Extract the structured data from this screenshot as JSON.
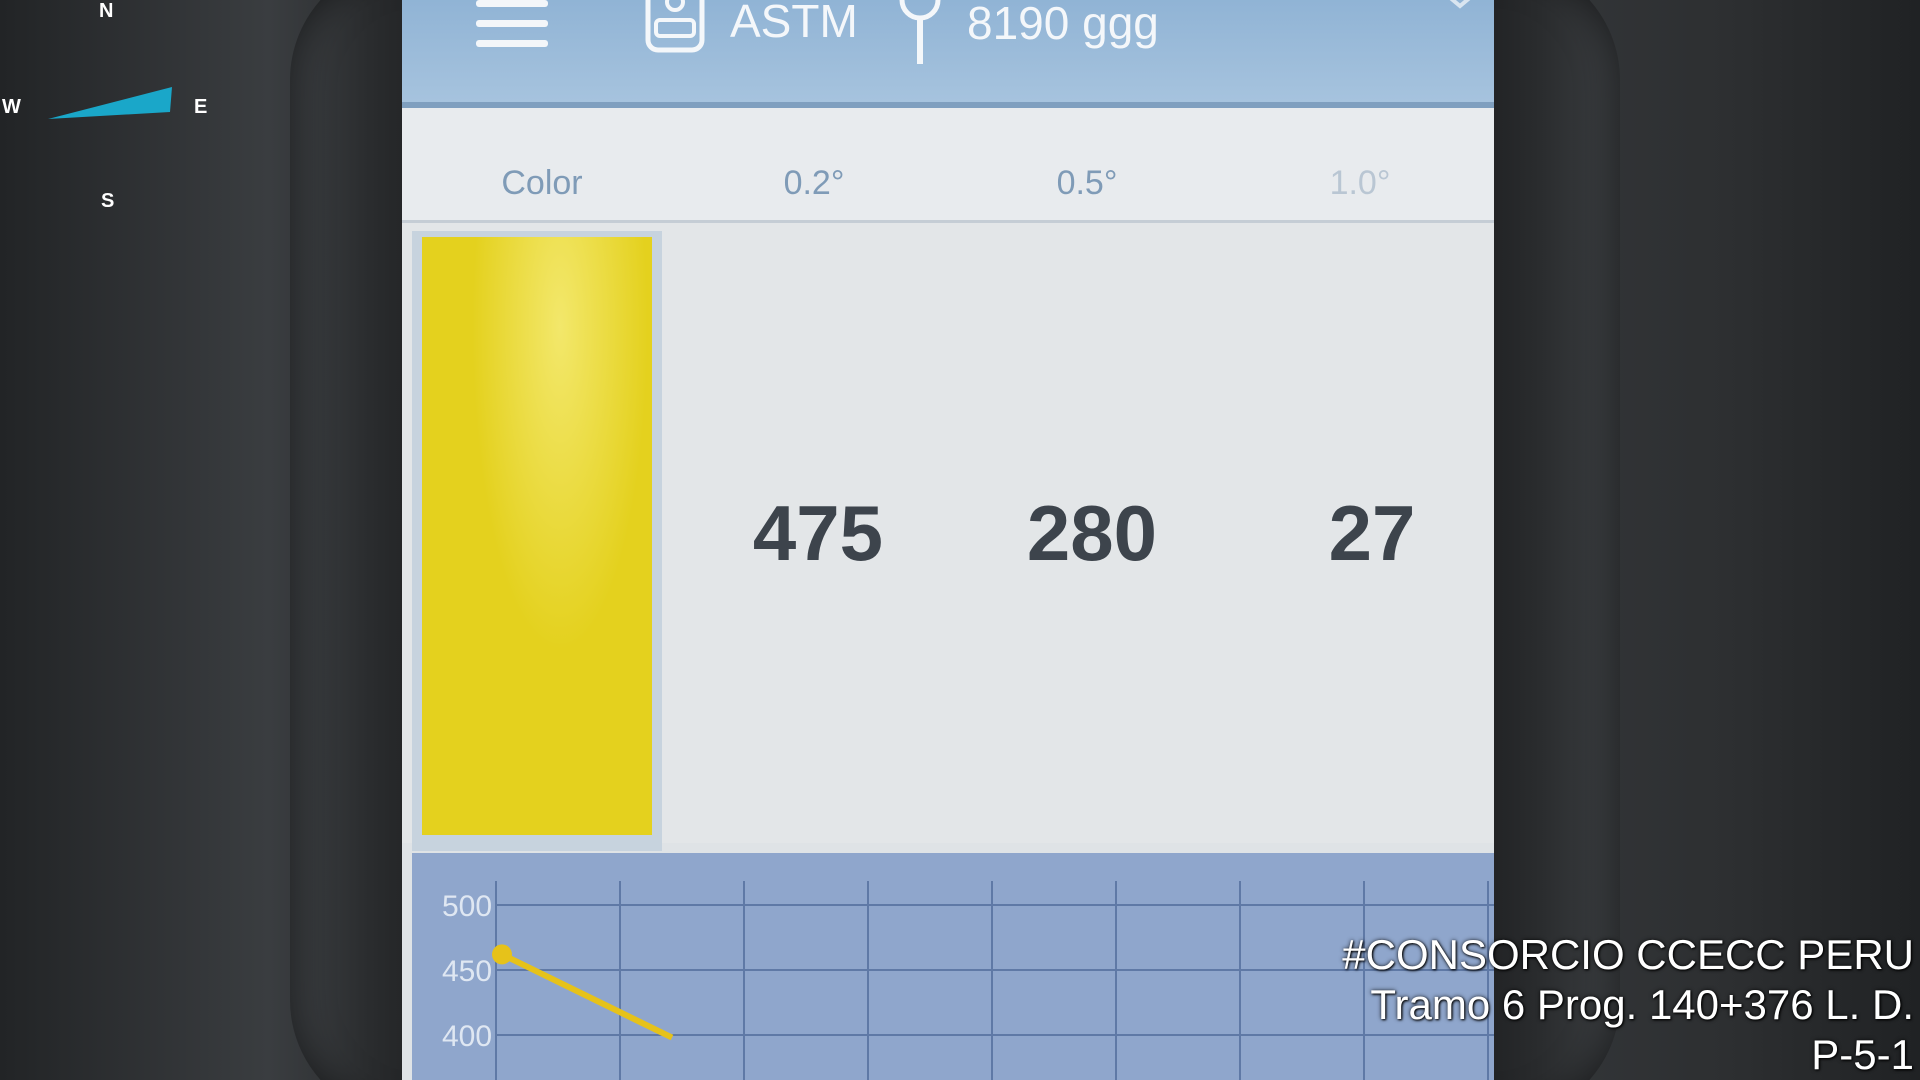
{
  "topbar": {
    "mode_label": "ASTM",
    "geometry_label": "8190 ggg"
  },
  "table": {
    "headers": [
      "Color",
      "0.2°",
      "0.5°",
      "1.0°"
    ],
    "readings": [
      "475",
      "280",
      "27"
    ],
    "swatch_color": "#e4d11e"
  },
  "chart_data": {
    "type": "line",
    "ytick_labels": [
      "500",
      "450",
      "400"
    ],
    "series": [
      {
        "color": "#e6c21a",
        "points": [
          [
            0,
            462
          ],
          [
            1,
            398
          ]
        ]
      }
    ]
  },
  "compass": {
    "north": "N",
    "east": "E",
    "south": "S",
    "west": "W",
    "needle_color": "#1aa7c9"
  },
  "watermark": {
    "line1": "#CONSORCIO CCECC PERU",
    "line2": "Tramo 6 Prog. 140+376 L. D.",
    "line3": "P-5-1"
  },
  "icons": {
    "menu": "menu-icon",
    "device": "device-icon",
    "geometry": "geometry-icon",
    "chevron": "chevron-down-icon"
  }
}
